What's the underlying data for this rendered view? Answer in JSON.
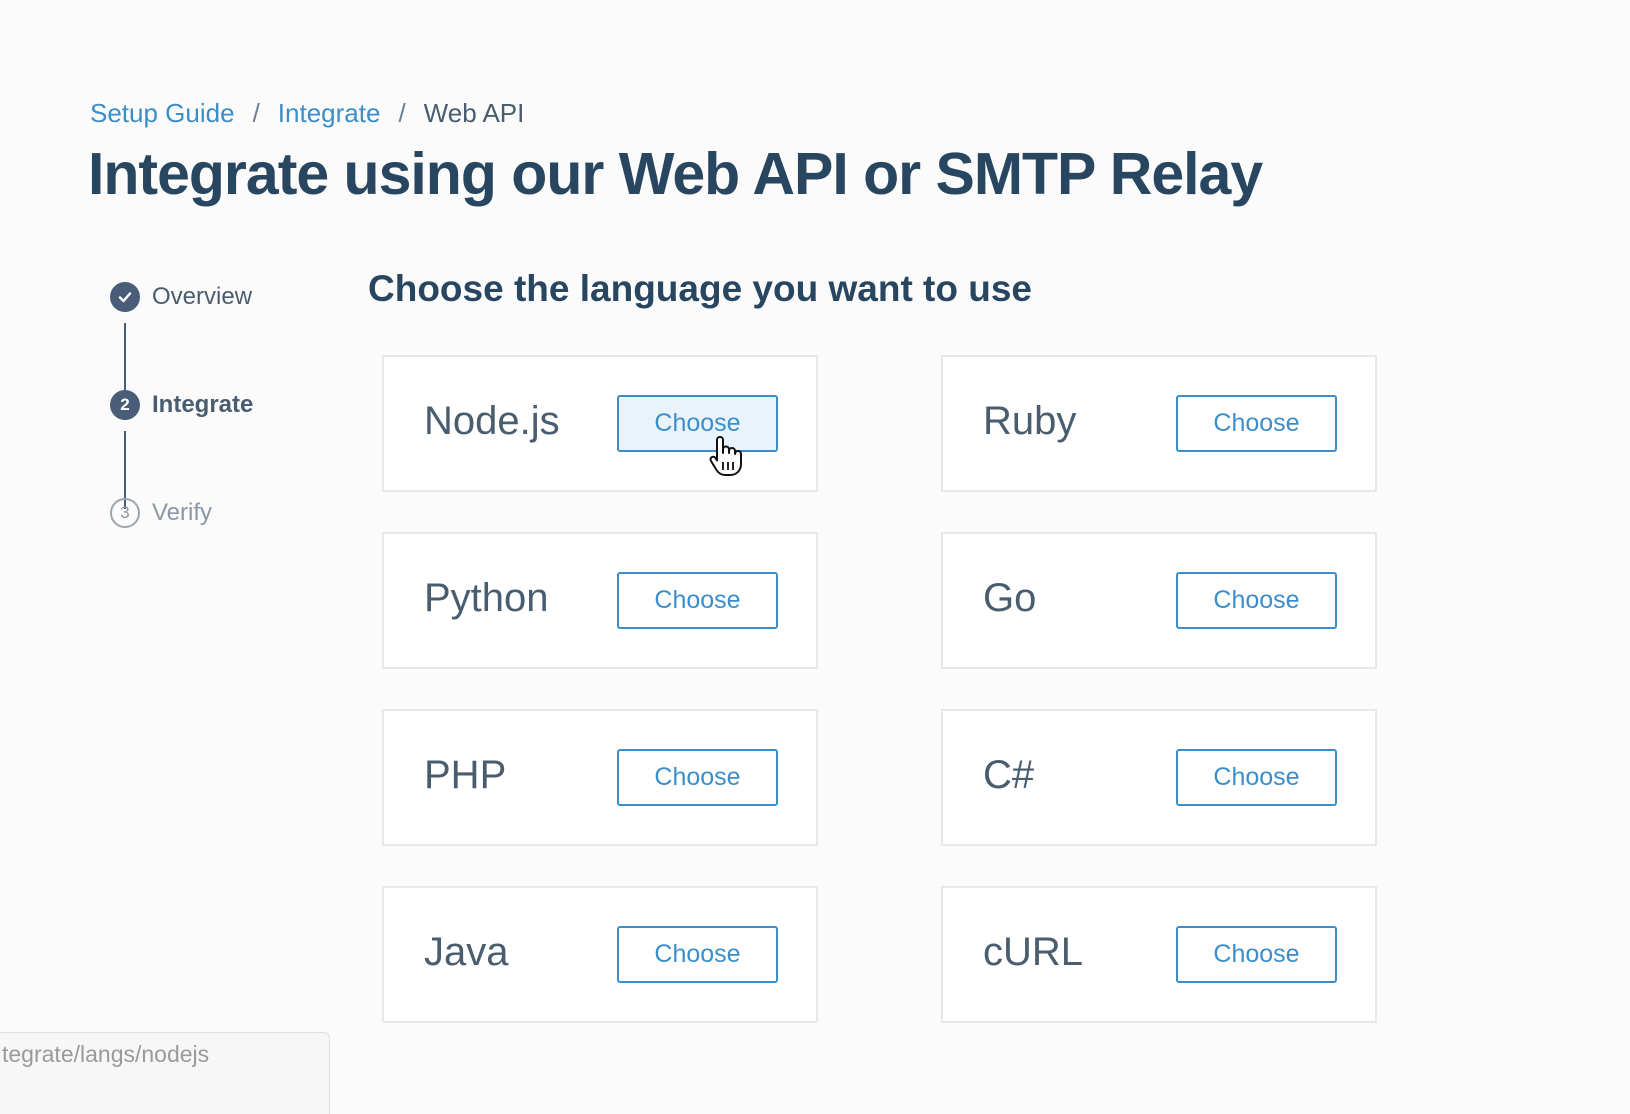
{
  "breadcrumb": {
    "items": [
      {
        "label": "Setup Guide"
      },
      {
        "label": "Integrate"
      }
    ],
    "current": "Web API",
    "separator": "/"
  },
  "page_title": "Integrate using our Web API or SMTP Relay",
  "stepper": {
    "steps": [
      {
        "label": "Overview",
        "marker": "",
        "state": "done"
      },
      {
        "label": "Integrate",
        "marker": "2",
        "state": "active"
      },
      {
        "label": "Verify",
        "marker": "3",
        "state": "pending"
      }
    ]
  },
  "section_title": "Choose the language you want to use",
  "languages": [
    {
      "name": "Node.js",
      "button": "Choose",
      "hovered": true
    },
    {
      "name": "Ruby",
      "button": "Choose"
    },
    {
      "name": "Python",
      "button": "Choose"
    },
    {
      "name": "Go",
      "button": "Choose"
    },
    {
      "name": "PHP",
      "button": "Choose"
    },
    {
      "name": "C#",
      "button": "Choose"
    },
    {
      "name": "Java",
      "button": "Choose"
    },
    {
      "name": "cURL",
      "button": "Choose"
    }
  ],
  "status_bar": {
    "url": "tegrate/langs/nodejs"
  },
  "colors": {
    "accent": "#3b8ec8",
    "heading": "#294661",
    "step_active": "#4a5d78"
  },
  "icons": {
    "step_done": "check-icon",
    "cursor": "hand-pointer-icon"
  }
}
